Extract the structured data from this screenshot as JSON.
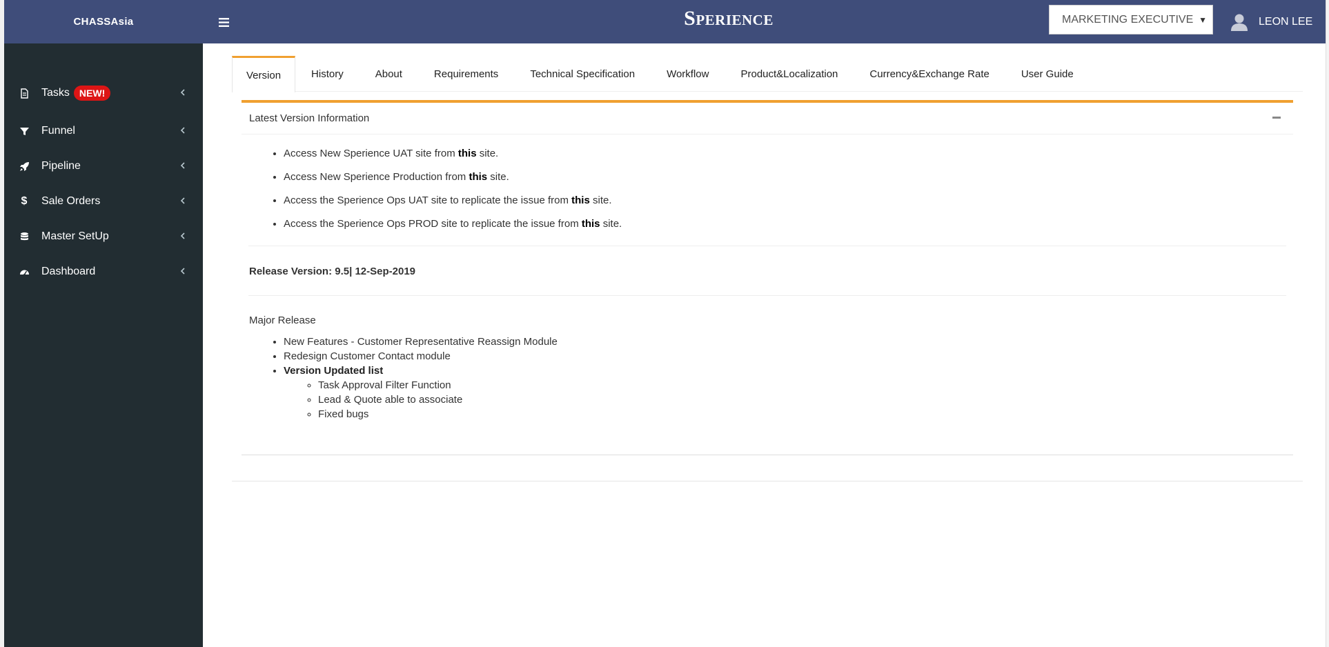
{
  "header": {
    "brand": "CHASSAsia",
    "title": "Sperience",
    "role": "MARKETING EXECUTIVE",
    "user_name": "LEON LEE"
  },
  "sidebar": {
    "items": [
      {
        "label": "Tasks",
        "icon": "document-icon",
        "badge": "NEW!"
      },
      {
        "label": "Funnel",
        "icon": "filter-icon"
      },
      {
        "label": "Pipeline",
        "icon": "rocket-icon"
      },
      {
        "label": "Sale Orders",
        "icon": "dollar-icon"
      },
      {
        "label": "Master SetUp",
        "icon": "database-icon"
      },
      {
        "label": "Dashboard",
        "icon": "dashboard-icon"
      }
    ]
  },
  "tabs": [
    {
      "label": "Version",
      "active": true
    },
    {
      "label": "History"
    },
    {
      "label": "About"
    },
    {
      "label": "Requirements"
    },
    {
      "label": "Technical Specification"
    },
    {
      "label": "Workflow"
    },
    {
      "label": "Product&Localization"
    },
    {
      "label": "Currency&Exchange Rate"
    },
    {
      "label": "User Guide"
    }
  ],
  "panel": {
    "title": "Latest Version Information",
    "links": [
      {
        "pre": "Access New Sperience UAT site from ",
        "link": "this",
        "post": " site."
      },
      {
        "pre": "Access New Sperience Production from ",
        "link": "this",
        "post": " site."
      },
      {
        "pre": "Access the Sperience Ops UAT site to replicate the issue from ",
        "link": "this",
        "post": " site."
      },
      {
        "pre": "Access the Sperience Ops PROD site to replicate the issue from ",
        "link": "this",
        "post": " site."
      }
    ],
    "release": "Release Version: 9.5| 12-Sep-2019",
    "major_title": "Major Release",
    "features": [
      "New Features - Customer Representative Reassign Module",
      "Redesign Customer Contact module",
      "Version Updated list"
    ],
    "updated_items": [
      "Task Approval Filter Function",
      "Lead & Quote able to associate",
      "Fixed bugs"
    ]
  },
  "colors": {
    "header_bg": "#3f4d7a",
    "sidebar_bg": "#222d32",
    "accent": "#f0a030",
    "badge": "#dd1515"
  }
}
